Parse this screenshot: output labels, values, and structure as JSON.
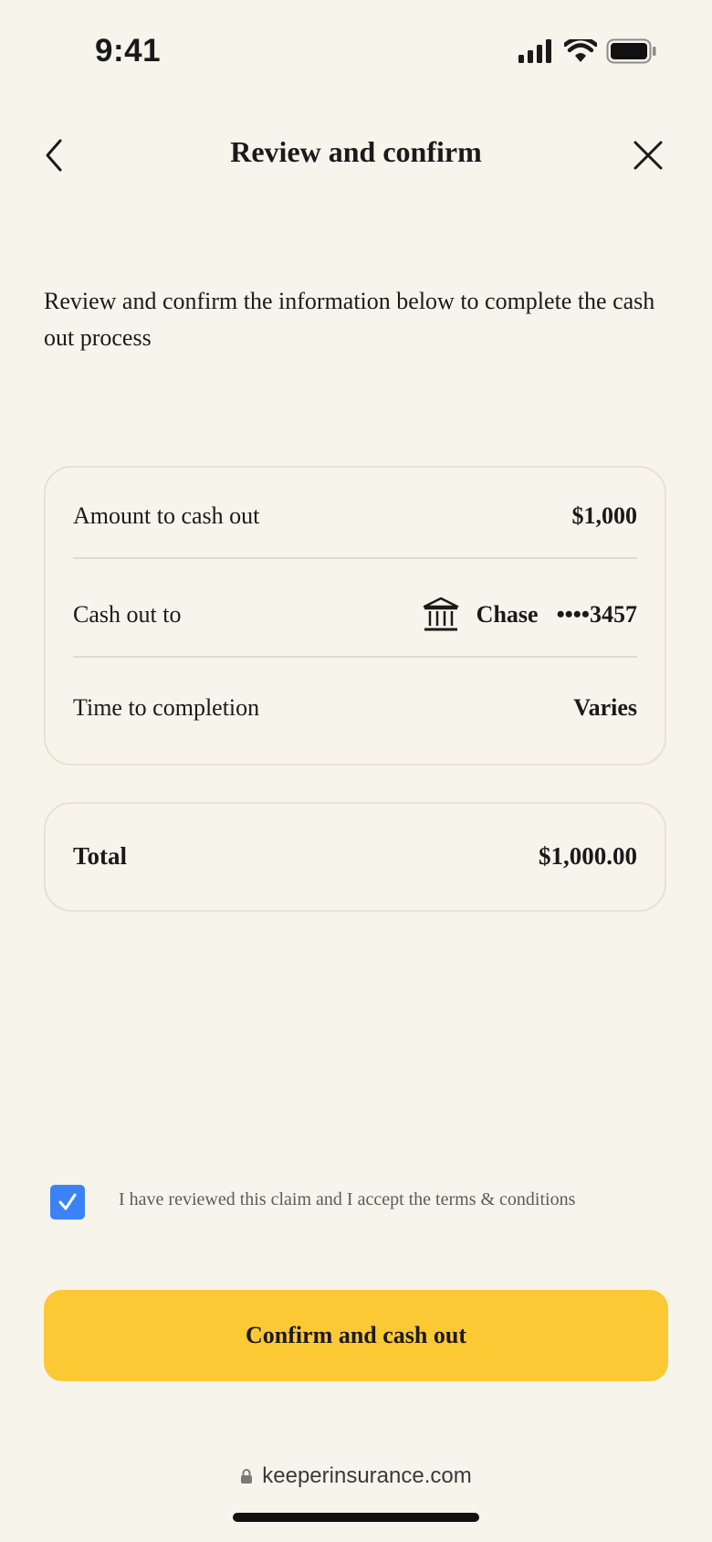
{
  "status_bar": {
    "time": "9:41",
    "icons": [
      "signal-icon",
      "wifi-icon",
      "battery-icon"
    ]
  },
  "nav": {
    "back_icon": "chevron-left-icon",
    "title": "Review and confirm",
    "close_icon": "close-icon"
  },
  "intro_text": "Review and confirm the information below to complete the cash out process",
  "details": {
    "amount_label": "Amount to cash out",
    "amount_value": "$1,000",
    "cash_out_to_label": "Cash out to",
    "bank_icon": "bank-icon",
    "bank_name": "Chase",
    "bank_account": "••••3457",
    "time_label": "Time to completion",
    "time_value": "Varies"
  },
  "total": {
    "label": "Total",
    "value": "$1,000.00"
  },
  "terms": {
    "checked": true,
    "text": "I have reviewed this claim and I accept the terms & conditions"
  },
  "cta_label": "Confirm and cash out",
  "browser": {
    "lock_icon": "lock-icon",
    "url": "keeperinsurance.com"
  },
  "colors": {
    "background": "#f7f4ec",
    "accent_button": "#fbc934",
    "checkbox": "#3b82f6",
    "card_border": "#e9e2cd"
  }
}
